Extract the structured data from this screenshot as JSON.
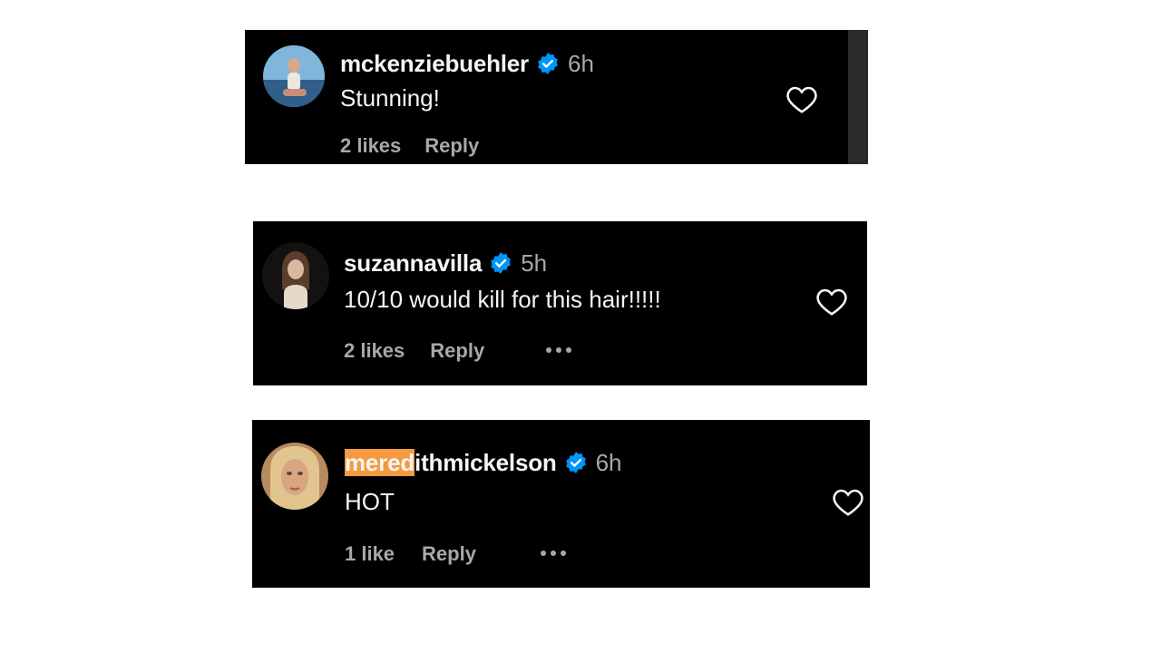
{
  "comments": [
    {
      "username": "mckenziebuehler",
      "username_highlight": "",
      "time": "6h",
      "text": "Stunning!",
      "likes": "2 likes",
      "reply_label": "Reply",
      "verified": true,
      "has_more_button": false,
      "avatar_icon": "avatar-photo"
    },
    {
      "username": "suzannavilla",
      "username_highlight": "",
      "time": "5h",
      "text": "10/10 would kill for this hair!!!!!",
      "likes": "2 likes",
      "reply_label": "Reply",
      "verified": true,
      "has_more_button": true,
      "avatar_icon": "avatar-photo"
    },
    {
      "username": "meredithmickelson",
      "username_highlight": "mered",
      "username_rest": "ithmickelson",
      "time": "6h",
      "text": "HOT",
      "likes": "1 like",
      "reply_label": "Reply",
      "verified": true,
      "has_more_button": true,
      "avatar_icon": "avatar-photo"
    }
  ],
  "colors": {
    "background": "#000000",
    "verified_badge": "#0095f6",
    "secondary_text": "#a8a8a8",
    "highlight": "#f59a3e"
  }
}
